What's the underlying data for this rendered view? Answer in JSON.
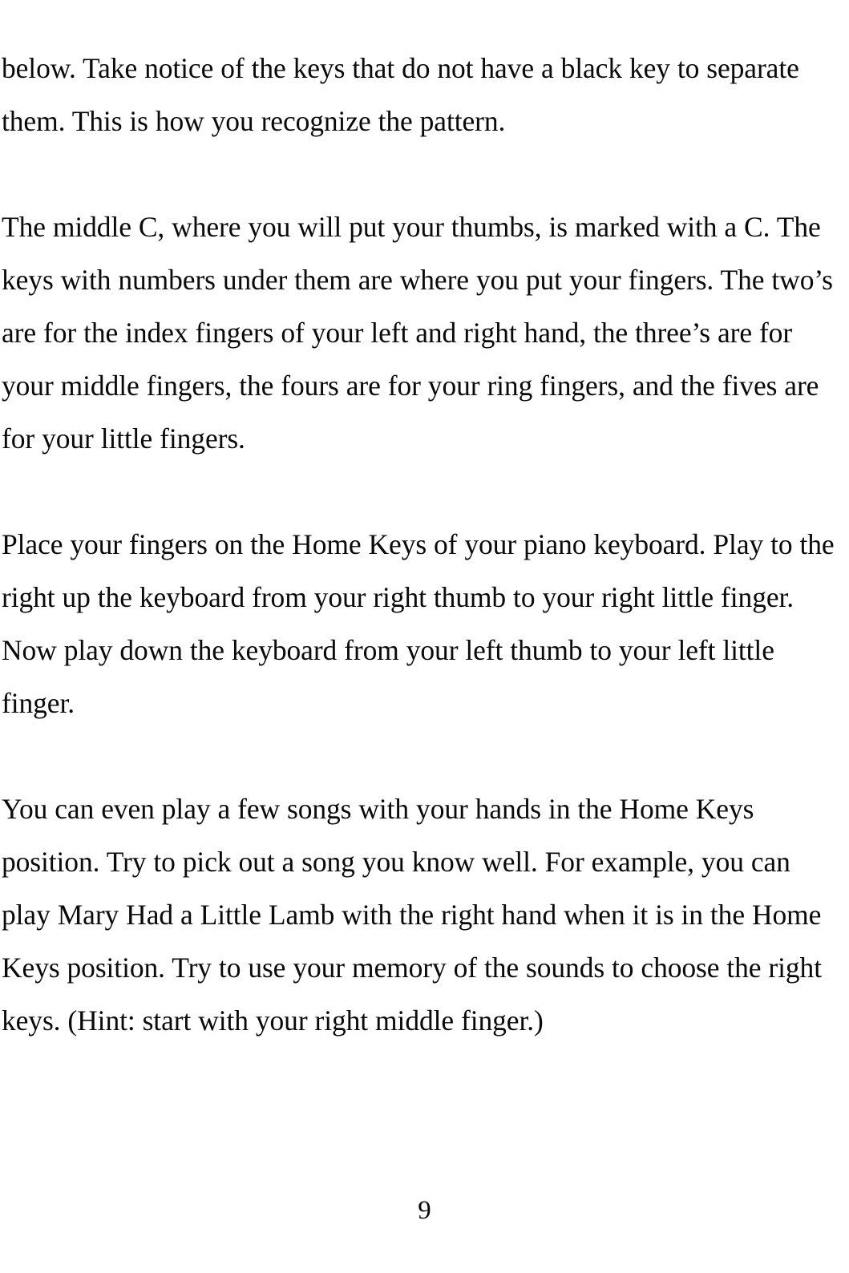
{
  "document": {
    "page_number": "9",
    "text_color": "#0a0a0a",
    "background_color": "#ffffff",
    "paragraphs": [
      {
        "id": "paragraph-keys-pattern",
        "text": "below. Take notice of the keys that do not have a black key to separate them. This is how you recognize the pattern."
      },
      {
        "id": "paragraph-middle-c-fingers",
        "text": "The middle C, where you will put your thumbs, is marked with a C. The keys with numbers under them are where you put your fingers. The two’s are for the index fingers of your left and right hand, the three’s are for your middle fingers, the fours are for your ring fingers, and the fives are for your little fingers."
      },
      {
        "id": "paragraph-home-keys-practice",
        "text": "Place your fingers on the Home Keys of your piano keyboard. Play to the right up the keyboard from your right thumb to your right little finger. Now play down the keyboard from your left thumb to your left little finger."
      },
      {
        "id": "paragraph-play-songs",
        "text": "You can even play a few songs with your hands in the Home Keys position. Try to pick out a song you know well. For example, you can play Mary Had a Little Lamb with the right hand when it is in the Home Keys position. Try to use your memory of the sounds to choose the right keys. (Hint: start with your right middle finger.)"
      }
    ]
  }
}
